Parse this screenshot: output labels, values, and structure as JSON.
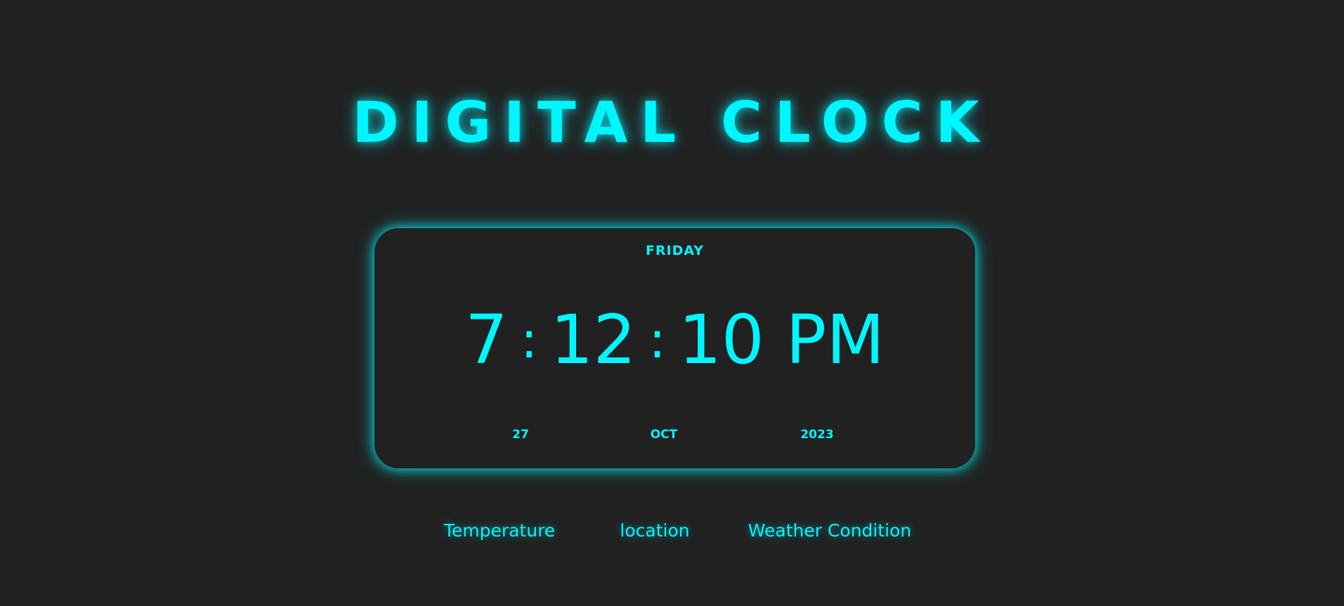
{
  "header": {
    "title": "DIGITAL CLOCK"
  },
  "clock": {
    "day": "FRIDAY",
    "hours": "7",
    "separator": ":",
    "minutes": "12",
    "seconds": "10",
    "period": "PM",
    "date": {
      "day": "27",
      "month": "OCT",
      "year": "2023"
    }
  },
  "info": {
    "temperature": "Temperature",
    "location": "location",
    "weather_condition": "Weather Condition"
  },
  "colors": {
    "background": "#212121",
    "accent": "#00f6ff"
  }
}
